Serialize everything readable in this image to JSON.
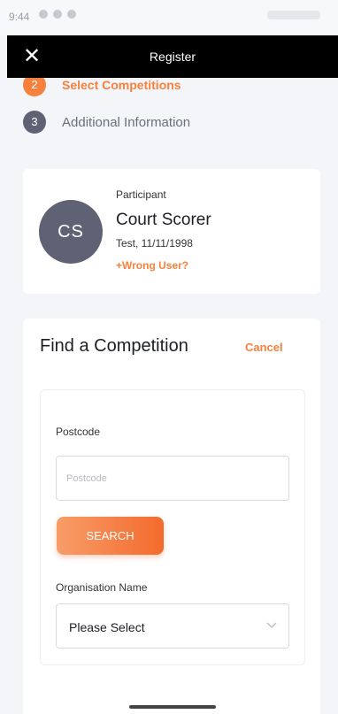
{
  "status_bar": {
    "time": "9:44"
  },
  "app_bar": {
    "title": "Register"
  },
  "steps": [
    {
      "number": "2",
      "label": "Select Competitions"
    },
    {
      "number": "3",
      "label": "Additional Information"
    }
  ],
  "participant": {
    "label": "Participant",
    "initials": "CS",
    "name": "Court Scorer",
    "details": "Test, 11/11/1998",
    "wrong_user_link": "+Wrong User?"
  },
  "find_competition": {
    "title": "Find a Competition",
    "cancel_label": "Cancel",
    "postcode_label": "Postcode",
    "postcode_placeholder": "Postcode",
    "postcode_value": "",
    "search_label": "SEARCH",
    "organisation_label": "Organisation Name",
    "organisation_selected": "Please Select"
  },
  "colors": {
    "accent": "#f7813c",
    "step_inactive": "#5f6275",
    "app_bar": "#000000"
  },
  "icons": [
    "close-icon",
    "chevron-down-icon"
  ]
}
